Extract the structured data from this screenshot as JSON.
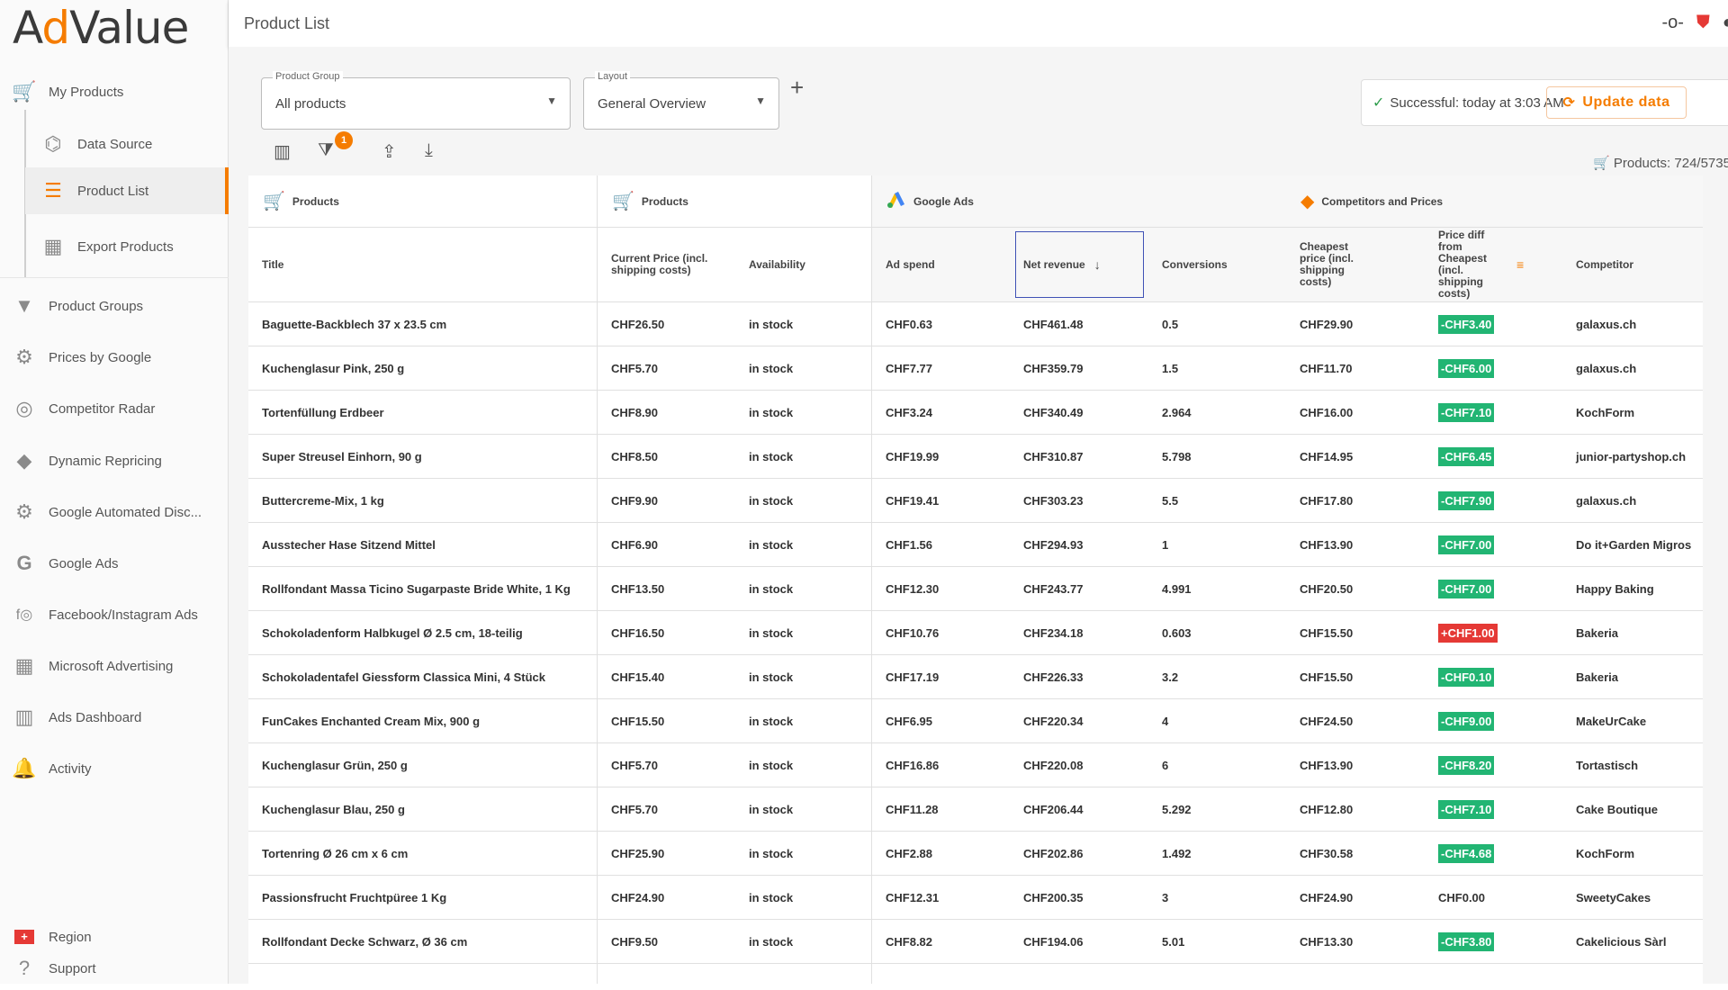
{
  "app": {
    "logo_prefix": "A",
    "logo_accent": "d",
    "logo_suffix": "Value",
    "accent_color": "#f57c00"
  },
  "sidebar": {
    "items": [
      {
        "label": "My Products",
        "icon": "cart-icon"
      },
      {
        "label": "Data Source",
        "icon": "data-source-icon"
      },
      {
        "label": "Product List",
        "icon": "list-icon"
      },
      {
        "label": "Export Products",
        "icon": "csv-icon"
      },
      {
        "label": "Product Groups",
        "icon": "filter-icon"
      },
      {
        "label": "Prices by Google",
        "icon": "google-prices-icon"
      },
      {
        "label": "Competitor Radar",
        "icon": "radar-icon"
      },
      {
        "label": "Dynamic Repricing",
        "icon": "tag-icon"
      },
      {
        "label": "Google Automated Disc...",
        "icon": "discount-icon"
      },
      {
        "label": "Google Ads",
        "icon": "google-icon"
      },
      {
        "label": "Facebook/Instagram Ads",
        "icon": "facebook-instagram-icon"
      },
      {
        "label": "Microsoft Advertising",
        "icon": "microsoft-icon"
      },
      {
        "label": "Ads Dashboard",
        "icon": "dashboard-icon"
      },
      {
        "label": "Activity",
        "icon": "bell-icon"
      }
    ],
    "region_label": "Region",
    "support_label": "Support"
  },
  "header": {
    "title": "Product List"
  },
  "filters": {
    "product_group_label": "Product Group",
    "product_group_value": "All products",
    "layout_label": "Layout",
    "layout_value": "General Overview",
    "filter_badge": "1"
  },
  "status": {
    "prefix": "Successful:",
    "time": "today at 3:03 AM",
    "update_label": "Update data",
    "products_count": "Products: 724/5735"
  },
  "table": {
    "groups": [
      "Products",
      "Products",
      "Google Ads",
      "Competitors and Prices"
    ],
    "columns": [
      "Title",
      "Current Price (incl. shipping costs)",
      "Availability",
      "Ad spend",
      "Net revenue",
      "Conversions",
      "Cheapest price (incl. shipping costs)",
      "Price diff from Cheapest (incl. shipping costs)",
      "Competitor"
    ],
    "rows": [
      {
        "title": "Baguette-Backblech 37 x 23.5 cm",
        "price": "CHF26.50",
        "avail": "in stock",
        "spend": "CHF0.63",
        "revenue": "CHF461.48",
        "conv": "0.5",
        "cheapest": "CHF29.90",
        "diff": "-CHF3.40",
        "diff_type": "green",
        "competitor": "galaxus.ch"
      },
      {
        "title": "Kuchenglasur Pink, 250 g",
        "price": "CHF5.70",
        "avail": "in stock",
        "spend": "CHF7.77",
        "revenue": "CHF359.79",
        "conv": "1.5",
        "cheapest": "CHF11.70",
        "diff": "-CHF6.00",
        "diff_type": "green",
        "competitor": "galaxus.ch"
      },
      {
        "title": "Tortenfüllung Erdbeer",
        "price": "CHF8.90",
        "avail": "in stock",
        "spend": "CHF3.24",
        "revenue": "CHF340.49",
        "conv": "2.964",
        "cheapest": "CHF16.00",
        "diff": "-CHF7.10",
        "diff_type": "green",
        "competitor": "KochForm"
      },
      {
        "title": "Super Streusel Einhorn, 90 g",
        "price": "CHF8.50",
        "avail": "in stock",
        "spend": "CHF19.99",
        "revenue": "CHF310.87",
        "conv": "5.798",
        "cheapest": "CHF14.95",
        "diff": "-CHF6.45",
        "diff_type": "green",
        "competitor": "junior-partyshop.ch"
      },
      {
        "title": "Buttercreme-Mix, 1 kg",
        "price": "CHF9.90",
        "avail": "in stock",
        "spend": "CHF19.41",
        "revenue": "CHF303.23",
        "conv": "5.5",
        "cheapest": "CHF17.80",
        "diff": "-CHF7.90",
        "diff_type": "green",
        "competitor": "galaxus.ch"
      },
      {
        "title": "Ausstecher Hase Sitzend Mittel",
        "price": "CHF6.90",
        "avail": "in stock",
        "spend": "CHF1.56",
        "revenue": "CHF294.93",
        "conv": "1",
        "cheapest": "CHF13.90",
        "diff": "-CHF7.00",
        "diff_type": "green",
        "competitor": "Do it+Garden Migros"
      },
      {
        "title": "Rollfondant Massa Ticino Sugarpaste Bride White, 1 Kg",
        "price": "CHF13.50",
        "avail": "in stock",
        "spend": "CHF12.30",
        "revenue": "CHF243.77",
        "conv": "4.991",
        "cheapest": "CHF20.50",
        "diff": "-CHF7.00",
        "diff_type": "green",
        "competitor": "Happy Baking"
      },
      {
        "title": "Schokoladenform Halbkugel Ø 2.5 cm, 18-teilig",
        "price": "CHF16.50",
        "avail": "in stock",
        "spend": "CHF10.76",
        "revenue": "CHF234.18",
        "conv": "0.603",
        "cheapest": "CHF15.50",
        "diff": "+CHF1.00",
        "diff_type": "red",
        "competitor": "Bakeria"
      },
      {
        "title": "Schokoladentafel Giessform Classica Mini, 4 Stück",
        "price": "CHF15.40",
        "avail": "in stock",
        "spend": "CHF17.19",
        "revenue": "CHF226.33",
        "conv": "3.2",
        "cheapest": "CHF15.50",
        "diff": "-CHF0.10",
        "diff_type": "green",
        "competitor": "Bakeria"
      },
      {
        "title": "FunCakes Enchanted Cream Mix, 900 g",
        "price": "CHF15.50",
        "avail": "in stock",
        "spend": "CHF6.95",
        "revenue": "CHF220.34",
        "conv": "4",
        "cheapest": "CHF24.50",
        "diff": "-CHF9.00",
        "diff_type": "green",
        "competitor": "MakeUrCake"
      },
      {
        "title": "Kuchenglasur Grün, 250 g",
        "price": "CHF5.70",
        "avail": "in stock",
        "spend": "CHF16.86",
        "revenue": "CHF220.08",
        "conv": "6",
        "cheapest": "CHF13.90",
        "diff": "-CHF8.20",
        "diff_type": "green",
        "competitor": "Tortastisch"
      },
      {
        "title": "Kuchenglasur Blau, 250 g",
        "price": "CHF5.70",
        "avail": "in stock",
        "spend": "CHF11.28",
        "revenue": "CHF206.44",
        "conv": "5.292",
        "cheapest": "CHF12.80",
        "diff": "-CHF7.10",
        "diff_type": "green",
        "competitor": "Cake Boutique"
      },
      {
        "title": "Tortenring Ø 26 cm x 6 cm",
        "price": "CHF25.90",
        "avail": "in stock",
        "spend": "CHF2.88",
        "revenue": "CHF202.86",
        "conv": "1.492",
        "cheapest": "CHF30.58",
        "diff": "-CHF4.68",
        "diff_type": "green",
        "competitor": "KochForm"
      },
      {
        "title": "Passionsfrucht Fruchtpüree 1 Kg",
        "price": "CHF24.90",
        "avail": "in stock",
        "spend": "CHF12.31",
        "revenue": "CHF200.35",
        "conv": "3",
        "cheapest": "CHF24.90",
        "diff": "CHF0.00",
        "diff_type": "none",
        "competitor": "SweetyCakes"
      },
      {
        "title": "Rollfondant Decke Schwarz, Ø 36 cm",
        "price": "CHF9.50",
        "avail": "in stock",
        "spend": "CHF8.82",
        "revenue": "CHF194.06",
        "conv": "5.01",
        "cheapest": "CHF13.30",
        "diff": "-CHF3.80",
        "diff_type": "green",
        "competitor": "Cakelicious Sàrl"
      }
    ]
  }
}
